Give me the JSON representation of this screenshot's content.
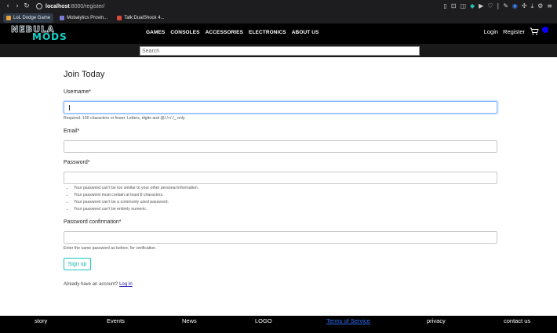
{
  "browser": {
    "url_host": "localhost",
    "url_path": ":8000/register/",
    "bookmarks": [
      {
        "label": "LoL Dodge Game",
        "color": "#e8a33a"
      },
      {
        "label": "Mobalytics Provin...",
        "color": "#7b7bd6"
      },
      {
        "label": "Talk:DualShock 4...",
        "color": "#d94a3a"
      }
    ]
  },
  "navbar": {
    "logo_top": "NEBULA",
    "logo_bottom": "MODS",
    "links": [
      "GAMES",
      "CONSOLES",
      "ACCESSORIES",
      "ELECTRONICS",
      "ABOUT US"
    ],
    "login": "Login",
    "register": "Register",
    "accent_color": "#0a00ff"
  },
  "search": {
    "placeholder": "Search"
  },
  "form": {
    "title": "Join Today",
    "username_label": "Username*",
    "username_help": "Required. 150 characters or fewer. Letters, digits and @/./+/-/_ only.",
    "email_label": "Email*",
    "password_label": "Password*",
    "password_rules": [
      "Your password can’t be too similar to your other personal information.",
      "Your password must contain at least 8 characters.",
      "Your password can’t be a commonly used password.",
      "Your password can’t be entirely numeric."
    ],
    "confirm_label": "Password confirmation*",
    "confirm_help": "Enter the same password as before, for verification.",
    "submit_label": "Sign up",
    "already_text": "Already have an account?",
    "login_link": "Log In"
  },
  "footer": {
    "story": "story",
    "events": "Events",
    "news": "News",
    "logo": "LOGO",
    "tos": "Terms of Service",
    "privacy": "privacy",
    "contact": "contact us"
  }
}
